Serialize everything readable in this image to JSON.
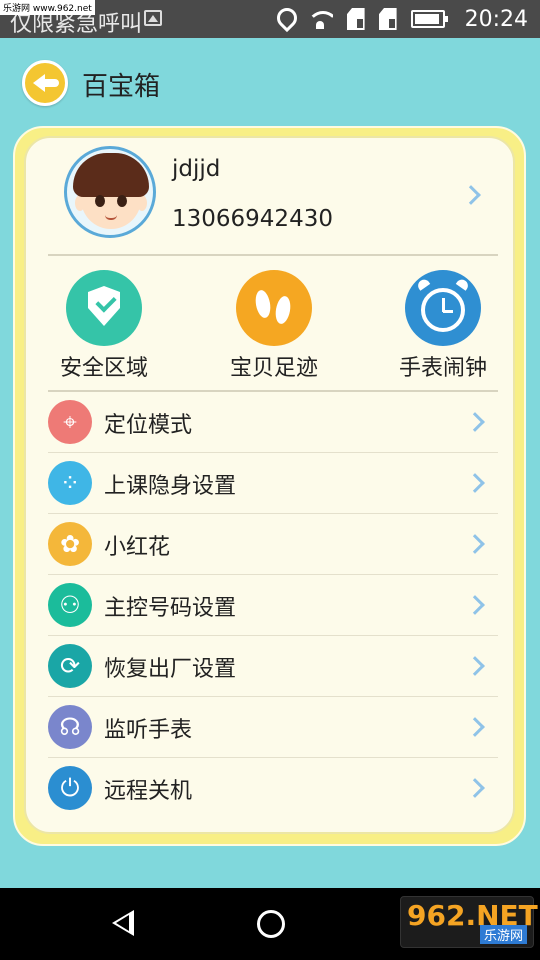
{
  "status_bar": {
    "notification_text": "仅限紧急呼叫",
    "watermark": "乐游网 www.962.net",
    "time": "20:24",
    "icons": [
      "gallery-icon",
      "location-icon",
      "wifi-icon",
      "sim1-icon",
      "sim2-icon",
      "battery-icon"
    ]
  },
  "header": {
    "title": "百宝箱",
    "back_icon": "back-arrow-icon"
  },
  "profile": {
    "username": "jdjjd",
    "phone": "13066942430"
  },
  "tools": [
    {
      "label": "安全区域",
      "icon": "shield-check-icon",
      "color": "#35c4a8"
    },
    {
      "label": "宝贝足迹",
      "icon": "footprints-icon",
      "color": "#f5a722"
    },
    {
      "label": "手表闹钟",
      "icon": "alarm-clock-icon",
      "color": "#2f8fd2"
    }
  ],
  "menu": [
    {
      "label": "定位模式",
      "icon": "location-pin-icon",
      "color": "#ee7a76"
    },
    {
      "label": "上课隐身设置",
      "icon": "hidden-person-icon",
      "color": "#3fb6e6"
    },
    {
      "label": "小红花",
      "icon": "flower-icon",
      "color": "#f4b73a"
    },
    {
      "label": "主控号码设置",
      "icon": "user-settings-icon",
      "color": "#1bbc9b"
    },
    {
      "label": "恢复出厂设置",
      "icon": "refresh-icon",
      "color": "#1aa6a6"
    },
    {
      "label": "监听手表",
      "icon": "headphones-icon",
      "color": "#7a86cc"
    },
    {
      "label": "远程关机",
      "icon": "power-icon",
      "color": "#2b8ed1"
    }
  ],
  "brand": {
    "main": "962.NET",
    "sub": "乐游网"
  },
  "colors": {
    "background": "#80d8dc",
    "card_border": "#f8ef86",
    "card_fill": "#fdfbea",
    "chevron": "#8fc3e8"
  }
}
